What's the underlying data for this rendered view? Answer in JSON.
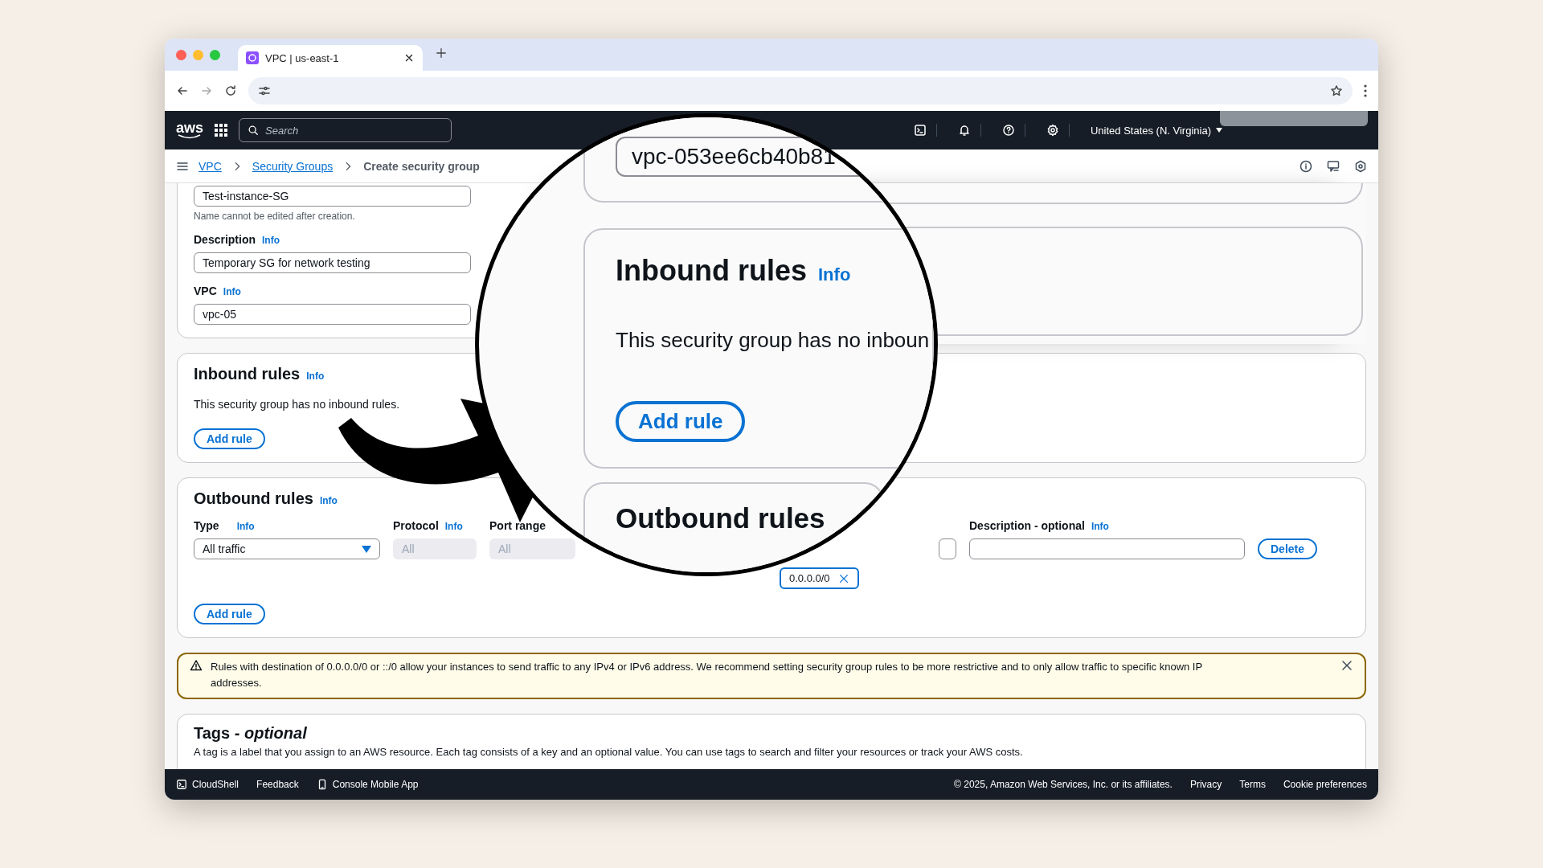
{
  "browser": {
    "tab_title": "VPC | us-east-1"
  },
  "console_header": {
    "logo": "aws",
    "search_placeholder": "Search",
    "region": "United States (N. Virginia)"
  },
  "breadcrumbs": [
    {
      "label": "VPC",
      "link": true
    },
    {
      "label": "Security Groups",
      "link": true
    },
    {
      "label": "Create security group",
      "link": false
    }
  ],
  "details": {
    "name_value": "Test-instance-SG",
    "name_hint": "Name cannot be edited after creation.",
    "fields": [
      {
        "label": "Description",
        "info": "Info",
        "value": "Temporary SG for network testing"
      },
      {
        "label": "VPC",
        "info": "Info",
        "value": "vpc-05"
      }
    ]
  },
  "inbound": {
    "title": "Inbound rules",
    "info": "Info",
    "empty_text": "This security group has no inbound rules.",
    "add_button": "Add rule"
  },
  "outbound": {
    "title": "Outbound rules",
    "info": "Info",
    "columns": [
      {
        "kind": "select",
        "label": "Type",
        "info": "Info",
        "value": "All traffic",
        "disabled": false
      },
      {
        "kind": "input",
        "label": "Protocol",
        "info": "Info",
        "value": "All",
        "disabled": true
      },
      {
        "kind": "input",
        "label": "Port range",
        "value": "All",
        "disabled": true
      },
      {
        "kind": "destination",
        "token": "0.0.0.0/0",
        "disabled": false
      },
      {
        "kind": "input",
        "label": "Description - optional",
        "info": "Info",
        "disabled": false
      }
    ],
    "delete_button": "Delete",
    "add_button": "Add rule"
  },
  "warning": {
    "text": "Rules with destination of 0.0.0.0/0 or ::/0 allow your instances to send traffic to any IPv4 or IPv6 address. We recommend setting security group rules to be more restrictive and to only allow traffic to specific known IP addresses."
  },
  "tags": {
    "title": "Tags - *optional*",
    "text": "A tag is a label that you assign to an AWS resource. Each tag consists of a key and an optional value. You can use tags to search and filter your resources or track your AWS costs."
  },
  "magnifier": {
    "vpc_value": "vpc-053ee6cb40b81",
    "title": "Inbound rules",
    "info": "Info",
    "empty_text": "This security group has no inboun",
    "add_button": "Add rule",
    "next_title": "Outbound rules"
  },
  "footer": {
    "cloudshell": "CloudShell",
    "feedback": "Feedback",
    "mobile_app": "Console Mobile App",
    "copyright": "© 2025, Amazon Web Services, Inc. or its affiliates.",
    "links": [
      "Privacy",
      "Terms",
      "Cookie preferences"
    ]
  }
}
